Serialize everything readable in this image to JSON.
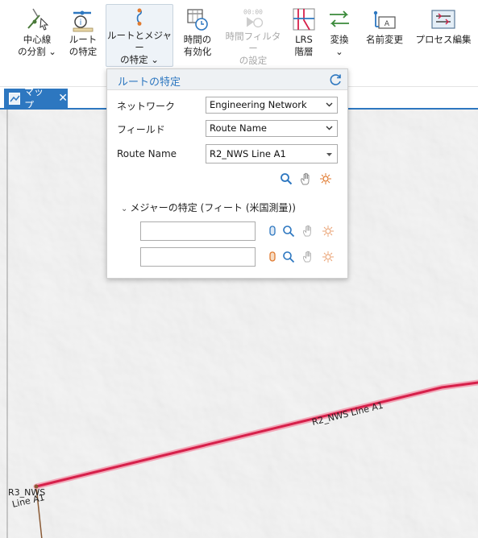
{
  "ribbon": {
    "buttons": [
      {
        "label": "中心線\nの分割 ⌄",
        "icon": "split-centerline-icon",
        "disabled": false
      },
      {
        "label": "ルート\nの特定",
        "icon": "identify-route-icon",
        "disabled": false
      },
      {
        "label": "ルートとメジャー\nの特定 ⌄",
        "icon": "identify-route-measure-icon",
        "disabled": false,
        "active": true
      },
      {
        "label": "時間の\n有効化",
        "icon": "enable-time-icon",
        "disabled": false
      },
      {
        "label": "時間フィルター\nの設定",
        "icon": "time-filter-icon",
        "disabled": true
      },
      {
        "label": "LRS\n階層",
        "icon": "lrs-hierarchy-icon",
        "disabled": false
      },
      {
        "label": "変換\n⌄",
        "icon": "convert-icon",
        "disabled": false
      },
      {
        "label": "名前変更",
        "icon": "rename-icon",
        "disabled": false
      },
      {
        "label": "プロセス編集",
        "icon": "process-edit-icon",
        "disabled": false
      }
    ]
  },
  "map_tab": {
    "label": "マップ",
    "close": "✕"
  },
  "panel": {
    "title": "ルートの特定",
    "fields": [
      {
        "label": "ネットワーク",
        "value": "Engineering Network"
      },
      {
        "label": "フィールド",
        "value": "Route Name"
      },
      {
        "label": "Route Name",
        "value": "R2_NWS Line A1"
      }
    ],
    "section_title": "メジャーの特定 (フィート (米国測量))",
    "measure_from": "",
    "measure_to": ""
  },
  "map": {
    "route_color": "#d6204a",
    "labels": {
      "r2": "R2_NWS Line A1",
      "r3_line1": "R3_NWS",
      "r3_line2": "Line A1"
    }
  }
}
